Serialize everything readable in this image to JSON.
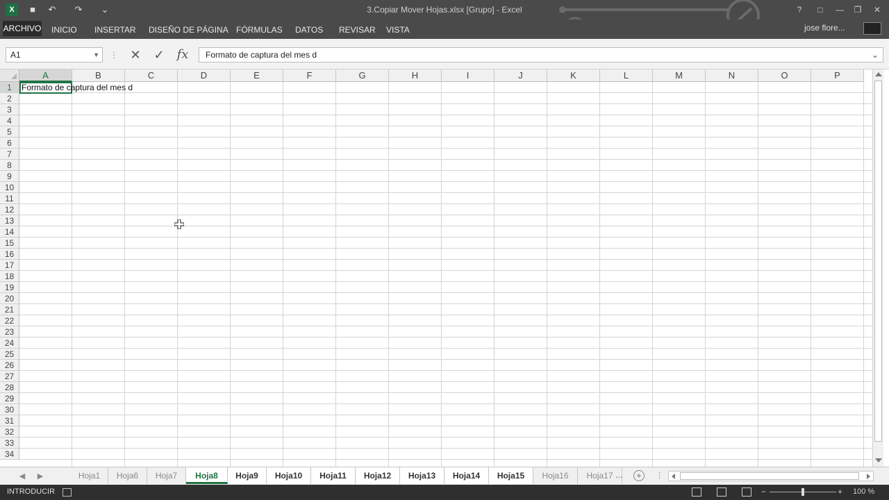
{
  "window": {
    "title": "3.Copiar Mover Hojas.xlsx [Grupo] - Excel",
    "minimize": "—",
    "restore": "❐",
    "close": "✕",
    "help": "?"
  },
  "quick_access": {
    "save_icon": "save-icon",
    "undo_icon": "undo-icon",
    "redo_icon": "redo-icon"
  },
  "ribbon": {
    "file_tab": "ARCHIVO",
    "tabs": [
      "INICIO",
      "INSERTAR",
      "DISEÑO DE PÁGINA",
      "FÓRMULAS",
      "DATOS",
      "REVISAR",
      "VISTA"
    ],
    "user": "jose flore..."
  },
  "formula_bar": {
    "name_box": "A1",
    "cancel": "✕",
    "enter": "✓",
    "fx": "fx",
    "content": "Formato de captura del mes d"
  },
  "sheet": {
    "columns": [
      "A",
      "B",
      "C",
      "D",
      "E",
      "F",
      "G",
      "H",
      "I",
      "J",
      "K",
      "L",
      "M",
      "N",
      "O",
      "P"
    ],
    "rows": [
      "1",
      "2",
      "3",
      "4",
      "5",
      "6",
      "7",
      "8",
      "9",
      "10",
      "11",
      "12",
      "13",
      "14",
      "15",
      "16",
      "17",
      "18",
      "19",
      "20",
      "21",
      "22",
      "23",
      "24",
      "25",
      "26",
      "27",
      "28",
      "29",
      "30",
      "31",
      "32",
      "33",
      "34"
    ],
    "active_cell": "A1",
    "a1_text": "Formato de captura del mes d"
  },
  "sheet_tabs": {
    "tabs": [
      {
        "label": "Hoja1",
        "state": "dim"
      },
      {
        "label": "Hoja6",
        "state": "dim"
      },
      {
        "label": "Hoja7",
        "state": "dim"
      },
      {
        "label": "Hoja8",
        "state": "active"
      },
      {
        "label": "Hoja9",
        "state": "grouped"
      },
      {
        "label": "Hoja10",
        "state": "grouped"
      },
      {
        "label": "Hoja11",
        "state": "grouped"
      },
      {
        "label": "Hoja12",
        "state": "grouped"
      },
      {
        "label": "Hoja13",
        "state": "grouped"
      },
      {
        "label": "Hoja14",
        "state": "grouped"
      },
      {
        "label": "Hoja15",
        "state": "grouped"
      },
      {
        "label": "Hoja16",
        "state": "dim"
      },
      {
        "label": "Hoja17",
        "state": "dim"
      }
    ],
    "more": "...",
    "add": "+"
  },
  "status_bar": {
    "mode": "INTRODUCIR",
    "zoom_minus": "−",
    "zoom_plus": "+",
    "zoom": "100 %"
  },
  "colors": {
    "accent": "#217346",
    "chrome": "#4a4a4a",
    "status": "#2f2f2f"
  }
}
